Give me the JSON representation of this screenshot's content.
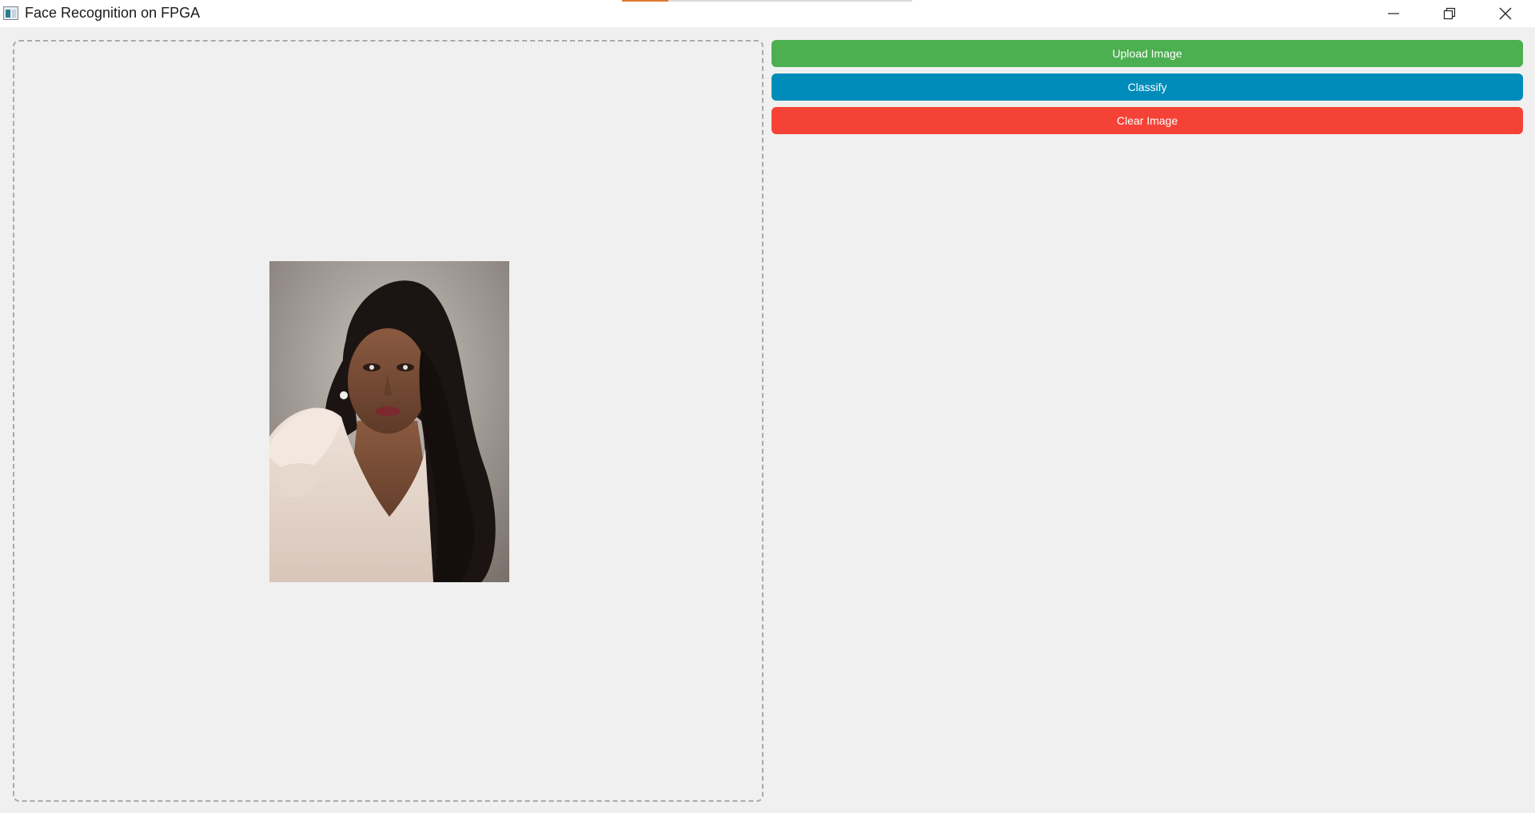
{
  "window": {
    "title": "Face Recognition on FPGA",
    "icon": "app-window-icon",
    "controls": {
      "minimize_icon": "minimize-icon",
      "maximize_icon": "restore-icon",
      "close_icon": "close-icon"
    }
  },
  "top_progress": {
    "fraction": 0.16,
    "color": "#e07b2c"
  },
  "buttons": {
    "upload_label": "Upload Image",
    "classify_label": "Classify",
    "clear_label": "Clear Image",
    "upload_color": "#4caf50",
    "classify_color": "#008cba",
    "clear_color": "#f44336"
  },
  "image_area": {
    "alt": "Portrait photo of a woman with long dark hair in a white lace dress",
    "has_image": true
  }
}
